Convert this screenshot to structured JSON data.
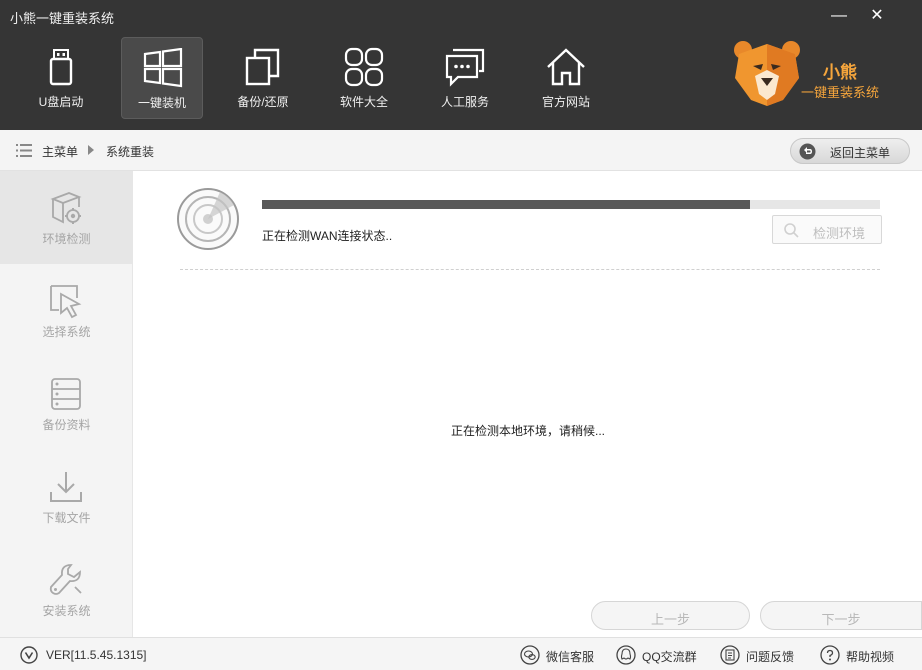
{
  "window": {
    "title": "小熊一键重装系统",
    "minimize_glyph": "—",
    "close_glyph": "✕"
  },
  "nav": {
    "items": [
      {
        "label": "U盘启动",
        "icon": "usb-drive-icon",
        "active": false
      },
      {
        "label": "一键装机",
        "icon": "windows-icon",
        "active": true
      },
      {
        "label": "备份/还原",
        "icon": "backup-copy-icon",
        "active": false
      },
      {
        "label": "软件大全",
        "icon": "apps-grid-icon",
        "active": false
      },
      {
        "label": "人工服务",
        "icon": "chat-bubble-icon",
        "active": false
      },
      {
        "label": "官方网站",
        "icon": "home-icon",
        "active": false
      }
    ]
  },
  "brand": {
    "name": "小熊",
    "subtitle": "一键重装系统",
    "logo_icon": "bear-logo-icon",
    "color": "#f5a53c"
  },
  "breadcrumb": {
    "home": "主菜单",
    "current": "系统重装",
    "back_button": "返回主菜单"
  },
  "sidebar": {
    "items": [
      {
        "label": "环境检测",
        "icon": "environment-check-icon",
        "active": true
      },
      {
        "label": "选择系统",
        "icon": "cursor-select-icon",
        "active": false
      },
      {
        "label": "备份资料",
        "icon": "server-backup-icon",
        "active": false
      },
      {
        "label": "下载文件",
        "icon": "download-icon",
        "active": false
      },
      {
        "label": "安装系统",
        "icon": "wrench-icon",
        "active": false
      }
    ]
  },
  "main": {
    "progress": 0.79,
    "status_text": "正在检测WAN连接状态..",
    "detect_button": "检测环境",
    "center_text": "正在检测本地环境，请稍候...",
    "prev_button": "上一步",
    "next_button": "下一步"
  },
  "footer": {
    "version": "VER[11.5.45.1315]",
    "links": [
      {
        "label": "微信客服",
        "icon": "wechat-icon"
      },
      {
        "label": "QQ交流群",
        "icon": "qq-icon"
      },
      {
        "label": "问题反馈",
        "icon": "feedback-icon"
      },
      {
        "label": "帮助视频",
        "icon": "help-icon"
      }
    ]
  }
}
